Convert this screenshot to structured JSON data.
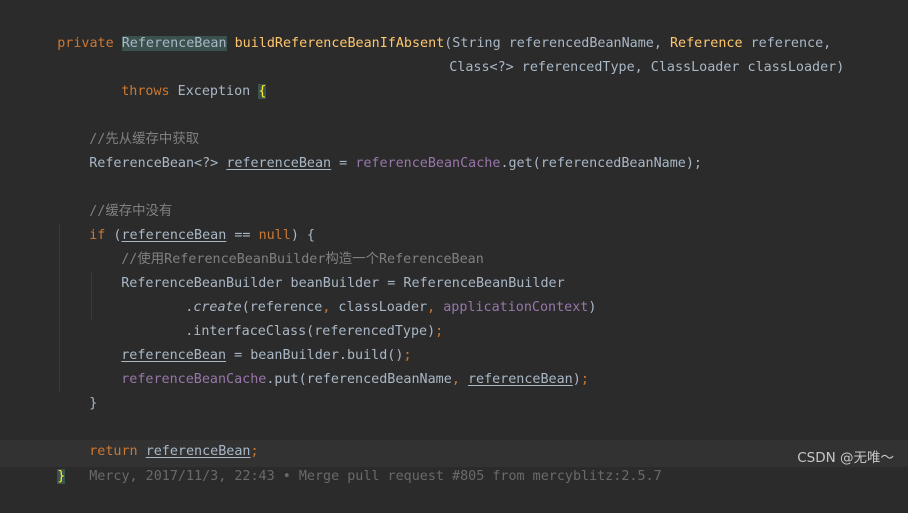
{
  "code": {
    "l1": [
      "private",
      " ",
      "ReferenceBean",
      " ",
      "buildReferenceBeanIfAbsent",
      "(String referencedBeanName, ",
      "Reference",
      " reference,"
    ],
    "l2": [
      "Class<?> referencedType, ClassLoader classLoader)"
    ],
    "l3": [
      "throws",
      " Exception ",
      "{"
    ],
    "l5": [
      "//先从缓存中获取"
    ],
    "l6": [
      "ReferenceBean<?> ",
      "referenceBean",
      " = ",
      "referenceBeanCache",
      ".get(referencedBeanName);"
    ],
    "l8": [
      "//缓存中没有"
    ],
    "l9": [
      "if",
      " (",
      "referenceBean",
      " == ",
      "null",
      ") {"
    ],
    "l10": [
      "//使用ReferenceBeanBuilder构造一个ReferenceBean"
    ],
    "l11": [
      "ReferenceBeanBuilder beanBuilder = ReferenceBeanBuilder"
    ],
    "l12": [
      ".",
      "create",
      "(reference",
      ",",
      " classLoader",
      ",",
      " applicationContext",
      ")"
    ],
    "l13": [
      ".interfaceClass(referencedType)",
      ";"
    ],
    "l14": [
      "referenceBean",
      " = beanBuilder.build()",
      ";"
    ],
    "l15": [
      "referenceBeanCache",
      ".put(referencedBeanName",
      ",",
      " ",
      "referenceBean",
      ")",
      ";"
    ],
    "l16": [
      "}"
    ],
    "l18": [
      "return",
      " ",
      "referenceBean",
      ";"
    ],
    "l19": [
      "}",
      "Mercy, 2017/11/3, 22:43 • Merge pull request #805 from mercyblitz:2.5.7"
    ]
  },
  "watermark": "CSDN @无唯～",
  "colors": {
    "background": "#2b2b2b",
    "keyword": "#cc7832",
    "method": "#ffc66d",
    "field": "#9876aa",
    "comment": "#808080",
    "text": "#a9b7c6"
  }
}
